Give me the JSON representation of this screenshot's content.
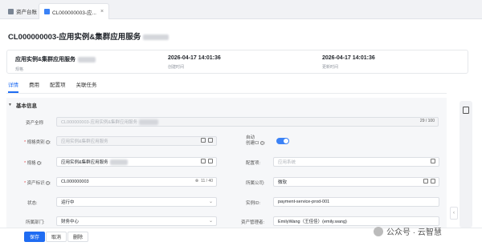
{
  "tabs": [
    {
      "label": "资产台账",
      "active": false
    },
    {
      "label": "CL000000003-应...",
      "active": true
    }
  ],
  "page_title": "CL000000003-应用实例&集群应用服务",
  "summary": [
    {
      "value": "应用实例&集群应用服务",
      "label": "规格"
    },
    {
      "value": "2026-04-17 14:01:36",
      "label": "创建时间"
    },
    {
      "value": "2026-04-17 14:01:36",
      "label": "更新时间"
    }
  ],
  "subtabs": [
    "详情",
    "费用",
    "配置项",
    "关联任务"
  ],
  "section_title": "基本信息",
  "form": {
    "asset_name": {
      "label": "资产全称",
      "value": "CL000000003-应用实例&集群应用服务",
      "count": "29 / 100"
    },
    "spec_category": {
      "label": "规格类别",
      "placeholder": "应用实例&集群应用服务"
    },
    "auto_create": {
      "label": "自动\n创建CI",
      "on": true
    },
    "spec": {
      "label": "规格",
      "value": "应用实例&集群应用服务"
    },
    "config_item": {
      "label": "配置项",
      "placeholder": "应用系统"
    },
    "asset_id": {
      "label": "资产标识",
      "value": "CL000000003",
      "count": "11 / 40"
    },
    "company": {
      "label": "所属公司",
      "value": "微软"
    },
    "status": {
      "label": "状态",
      "value": "运行中"
    },
    "instance_id": {
      "label": "实例ID",
      "value": "payment-service-prod-001"
    },
    "department": {
      "label": "所属部门",
      "value": "财务中心"
    },
    "owner": {
      "label": "资产管理者",
      "value": "EmilyWang（王佳佳）(emily.wang)"
    }
  },
  "buttons": {
    "save": "保存",
    "cancel": "取消",
    "delete": "删除"
  },
  "watermark": "公众号 · 云智慧",
  "colors": {
    "primary": "#1f6cf2",
    "required": "#e5484d"
  }
}
